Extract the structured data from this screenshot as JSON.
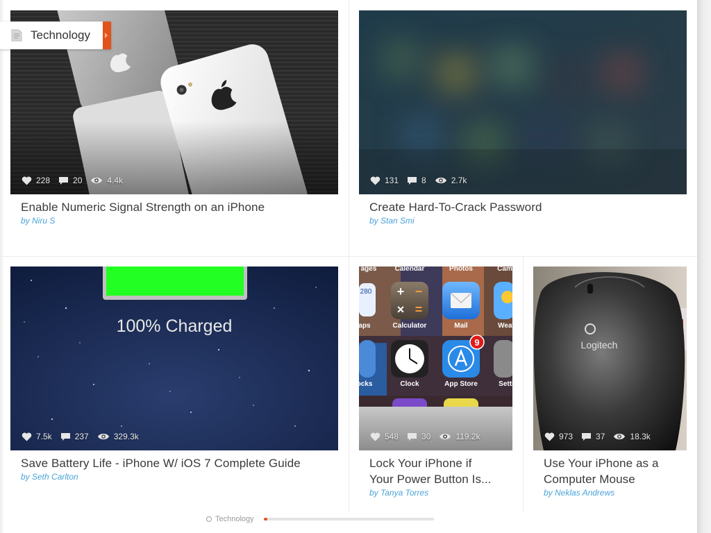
{
  "category_tag": {
    "label": "Technology",
    "icon": "document-icon",
    "accent": "#e2531c"
  },
  "articles": [
    {
      "title": "Enable Numeric Signal Strength on an iPhone",
      "author": "by Niru S",
      "likes": "228",
      "comments": "20",
      "views": "4.4k"
    },
    {
      "title": "Create Hard-To-Crack Password",
      "author": "by Stan Smi",
      "likes": "131",
      "comments": "8",
      "views": "2.7k"
    },
    {
      "title": "Save Battery Life - iPhone W/ iOS 7 Complete Guide",
      "author": "by Seth Carlton",
      "likes": "7.5k",
      "comments": "237",
      "views": "329.3k",
      "image_text": "100% Charged"
    },
    {
      "title_line1": "Lock Your iPhone if",
      "title_line2": "Your Power Button Is...",
      "author": "by Tanya Torres",
      "likes": "548",
      "comments": "30",
      "views": "119.2k",
      "image_labels": {
        "top": [
          "ages",
          "Calendar",
          "Photos",
          "Cam"
        ],
        "row1": [
          "aps",
          "Calculator",
          "Mail",
          "Weat"
        ],
        "row2": [
          "ocks",
          "Clock",
          "App Store",
          "Setti"
        ],
        "badge": "9",
        "partial": "280"
      }
    },
    {
      "title_line1": "Use Your iPhone as a",
      "title_line2": "Computer Mouse",
      "author": "by Neklas Andrews",
      "likes": "973",
      "comments": "37",
      "views": "18.3k",
      "image_text": "Logitech"
    }
  ],
  "footer": {
    "label": "Technology",
    "progress": 0.02,
    "accent": "#e2531c"
  }
}
